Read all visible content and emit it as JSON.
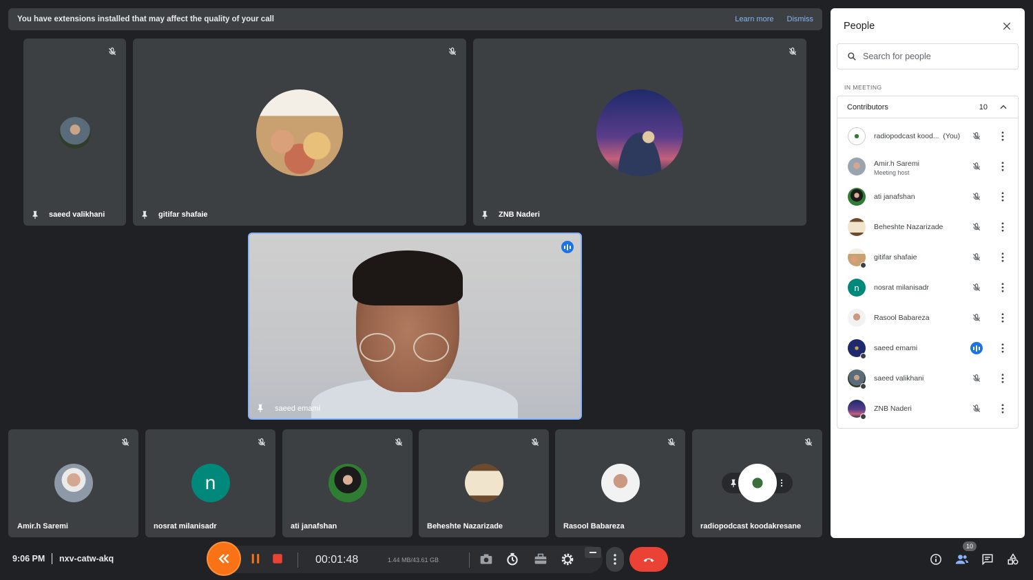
{
  "banner": {
    "text": "You have extensions installed that may affect the quality of your call",
    "learn_more": "Learn more",
    "dismiss": "Dismiss"
  },
  "tiles_top": [
    {
      "name": "saeed valikhani"
    },
    {
      "name": "gitifar shafaie"
    },
    {
      "name": "ZNB Naderi"
    }
  ],
  "speaker": {
    "name": "saeed emami"
  },
  "tiles_bottom": [
    {
      "name": "Amir.h Saremi",
      "initial": ""
    },
    {
      "name": "nosrat milanisadr",
      "initial": "n"
    },
    {
      "name": "ati janafshan",
      "initial": ""
    },
    {
      "name": "Beheshte Nazarizade",
      "initial": ""
    },
    {
      "name": "Rasool Babareza",
      "initial": ""
    },
    {
      "name": "radiopodcast koodakresane",
      "initial": ""
    }
  ],
  "panel": {
    "title": "People",
    "search_placeholder": "Search for people",
    "section_label": "IN MEETING",
    "group_label": "Contributors",
    "group_count": "10",
    "participants": [
      {
        "name": "radiopodcast kood...",
        "suffix": "(You)",
        "sub": "",
        "speaking": false
      },
      {
        "name": "Amir.h Saremi",
        "suffix": "",
        "sub": "Meeting host",
        "speaking": false
      },
      {
        "name": "ati janafshan",
        "suffix": "",
        "sub": "",
        "speaking": false
      },
      {
        "name": "Beheshte Nazarizade",
        "suffix": "",
        "sub": "",
        "speaking": false
      },
      {
        "name": "gitifar shafaie",
        "suffix": "",
        "sub": "",
        "speaking": false
      },
      {
        "name": "nosrat milanisadr",
        "suffix": "",
        "sub": "",
        "speaking": false,
        "initial": "n"
      },
      {
        "name": "Rasool Babareza",
        "suffix": "",
        "sub": "",
        "speaking": false
      },
      {
        "name": "saeed emami",
        "suffix": "",
        "sub": "",
        "speaking": true
      },
      {
        "name": "saeed valikhani",
        "suffix": "",
        "sub": "",
        "speaking": false
      },
      {
        "name": "ZNB Naderi",
        "suffix": "",
        "sub": "",
        "speaking": false
      }
    ]
  },
  "bottombar": {
    "time": "9:06 PM",
    "meeting_code": "nxv-catw-akq",
    "timer": "00:01:48",
    "storage": "1.44 MB/43.61 GB",
    "people_count": "10"
  },
  "colors": {
    "background": "#202124",
    "tile": "#3c4043",
    "accent": "#8ab4f8",
    "hangup": "#ea4335",
    "record_orange": "#f97316",
    "record_red": "#ea4335"
  }
}
